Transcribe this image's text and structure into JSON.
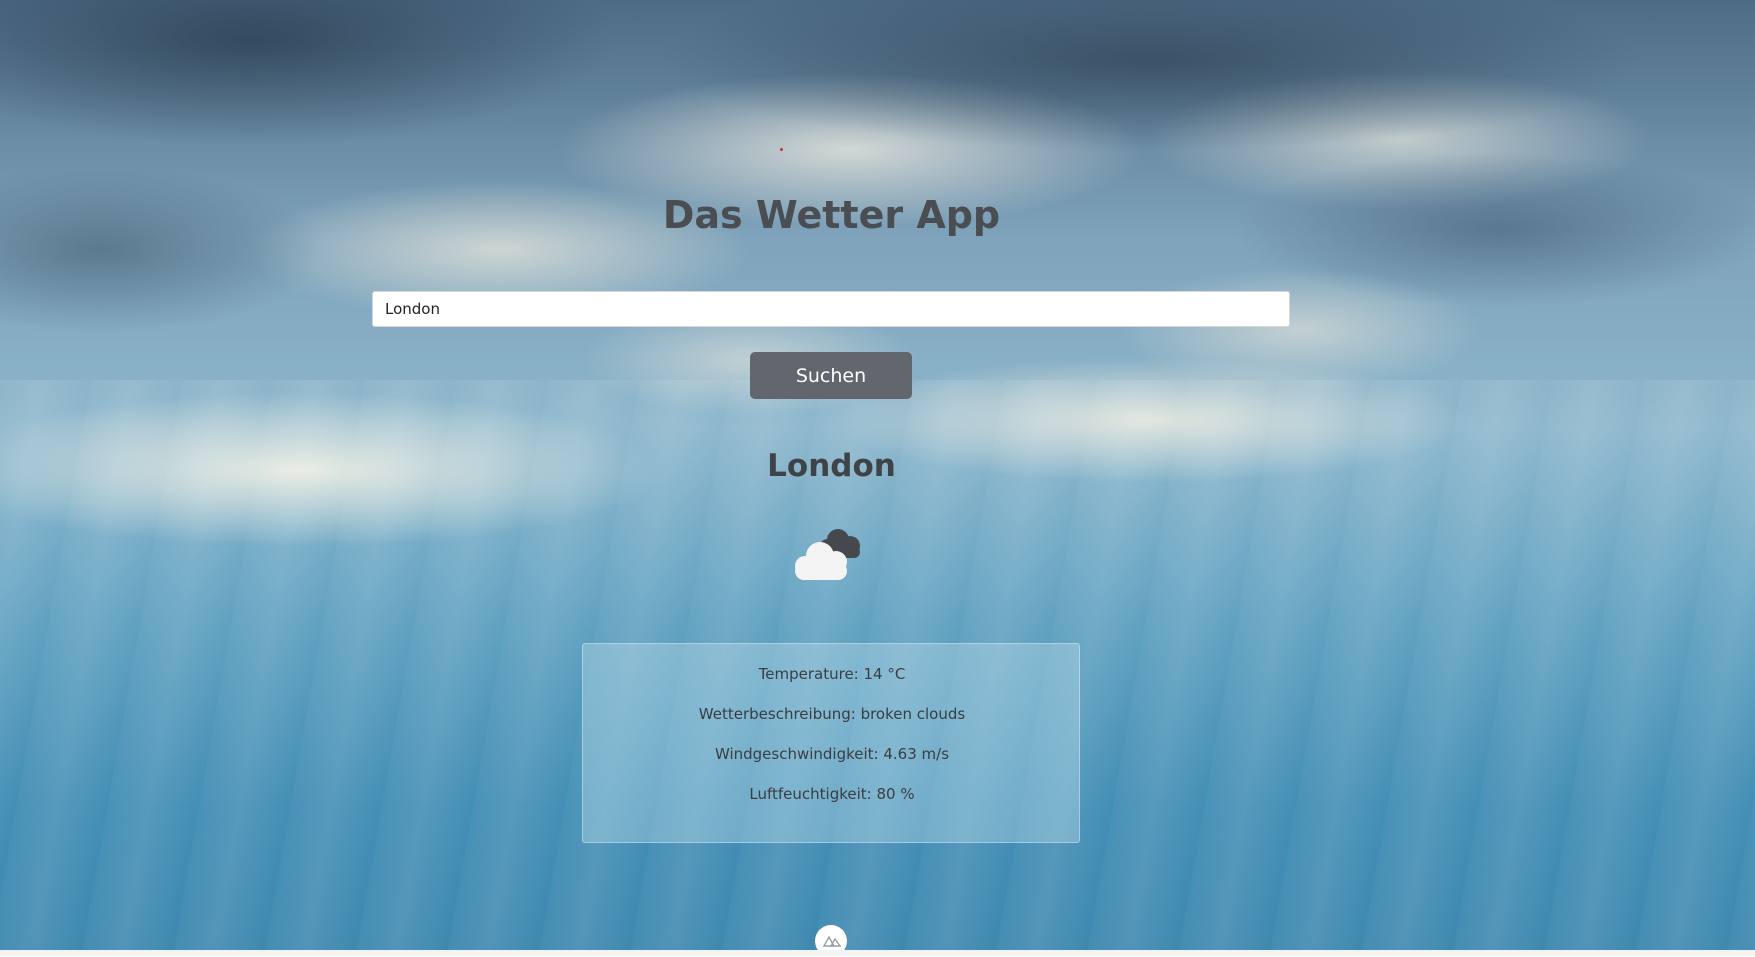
{
  "app": {
    "title": "Das Wetter App"
  },
  "search": {
    "value": "London",
    "button_label": "Suchen"
  },
  "result": {
    "city": "London",
    "icon": "broken-clouds-icon",
    "temperature": "Temperature: 14 °C",
    "description": "Wetterbeschreibung: broken clouds",
    "wind": "Windgeschwindigkeit: 4.63 m/s",
    "humidity": "Luftfeuchtigkeit: 80 %"
  },
  "footer": {
    "icon": "nuxt-logo-icon"
  },
  "colors": {
    "button": "#62666d",
    "title": "#4a4d51",
    "card": "#c8e4f0"
  }
}
